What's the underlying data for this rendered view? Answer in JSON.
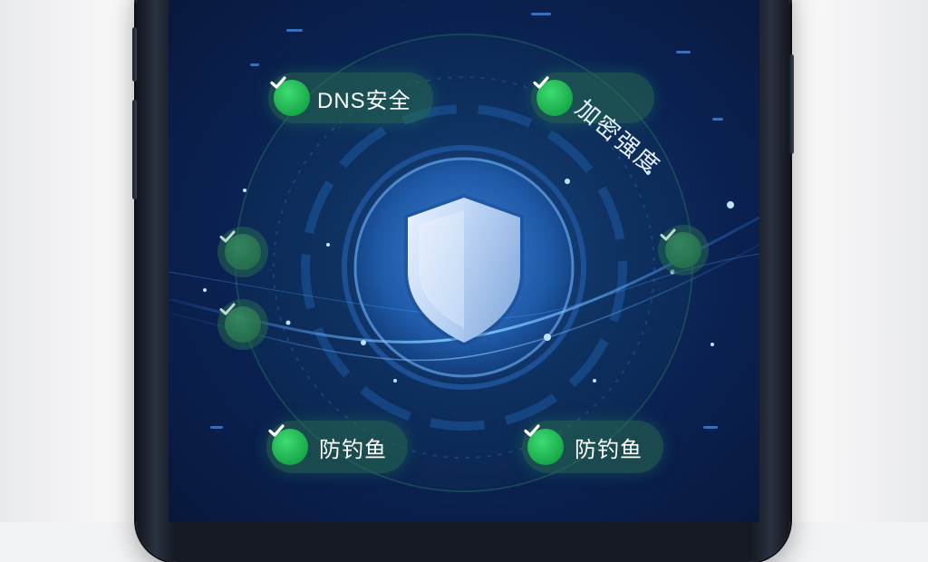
{
  "badges": {
    "dns": {
      "label": "DNS安全",
      "icon": "check-icon"
    },
    "encryption": {
      "label": "加密强度",
      "icon": "check-icon"
    },
    "phishing_left": {
      "label": "防钓鱼",
      "icon": "check-icon"
    },
    "phishing_right": {
      "label": "防钓鱼",
      "icon": "check-icon"
    }
  },
  "side_checks": [
    "check-icon",
    "check-icon",
    "check-icon"
  ],
  "center_icon": "shield-icon",
  "colors": {
    "background": "#0a2150",
    "accent_green": "#19a94a",
    "glow_blue": "#4aa3ff"
  }
}
